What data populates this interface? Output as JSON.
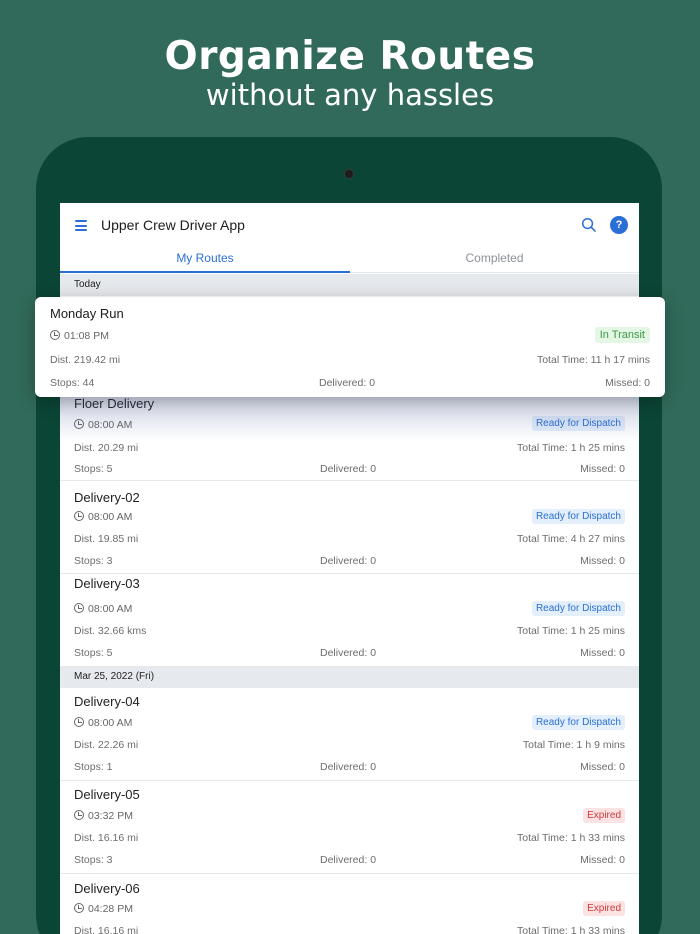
{
  "hero": {
    "title": "Organize Routes",
    "subtitle": "without any hassles"
  },
  "app": {
    "title": "Upper Crew Driver App"
  },
  "tabs": [
    {
      "label": "My Routes"
    },
    {
      "label": "Completed"
    }
  ],
  "sections": [
    {
      "label": "Today"
    },
    {
      "label": "Mar 25, 2022 (Fri)"
    }
  ],
  "highlight": {
    "name": "Monday Run",
    "time": "01:08 PM",
    "status": "In Transit",
    "dist": "Dist. 219.42 mi",
    "total": "Total Time: 11 h 17 mins",
    "stops": "Stops: 44",
    "delivered": "Delivered: 0",
    "missed": "Missed: 0"
  },
  "routes": [
    {
      "name": "Floer Delivery",
      "time": "08:00 AM",
      "status": "Ready for Dispatch",
      "dist": "Dist. 20.29 mi",
      "total": "Total Time: 1 h 25 mins",
      "stops": "Stops: 5",
      "delivered": "Delivered: 0",
      "missed": "Missed: 0"
    },
    {
      "name": "Delivery-02",
      "time": "08:00 AM",
      "status": "Ready for Dispatch",
      "dist": "Dist. 19.85 mi",
      "total": "Total Time: 4 h 27 mins",
      "stops": "Stops: 3",
      "delivered": "Delivered: 0",
      "missed": "Missed: 0"
    },
    {
      "name": "Delivery-03",
      "time": "08:00 AM",
      "status": "Ready for Dispatch",
      "dist": "Dist. 32.66 kms",
      "total": "Total Time: 1 h 25 mins",
      "stops": "Stops: 5",
      "delivered": "Delivered: 0",
      "missed": "Missed: 0"
    },
    {
      "name": "Delivery-04",
      "time": "08:00 AM",
      "status": "Ready for Dispatch",
      "dist": "Dist. 22.26 mi",
      "total": "Total Time: 1 h 9 mins",
      "stops": "Stops: 1",
      "delivered": "Delivered: 0",
      "missed": "Missed: 0"
    },
    {
      "name": "Delivery-05",
      "time": "03:32 PM",
      "status": "Expired",
      "dist": "Dist. 16.16 mi",
      "total": "Total Time: 1 h 33 mins",
      "stops": "Stops: 3",
      "delivered": "Delivered: 0",
      "missed": "Missed: 0"
    },
    {
      "name": "Delivery-06",
      "time": "04:28 PM",
      "status": "Expired",
      "dist": "Dist. 16.16 mi",
      "total": "Total Time: 1 h 33 mins",
      "stops": "",
      "delivered": "",
      "missed": ""
    }
  ],
  "colors": {
    "background": "#316a5a",
    "device": "#0b4535",
    "accent": "#2b6fd6",
    "ready_badge": "#e3effb",
    "expired_badge": "#fbe3e3",
    "transit_badge": "#e4f6e4"
  }
}
